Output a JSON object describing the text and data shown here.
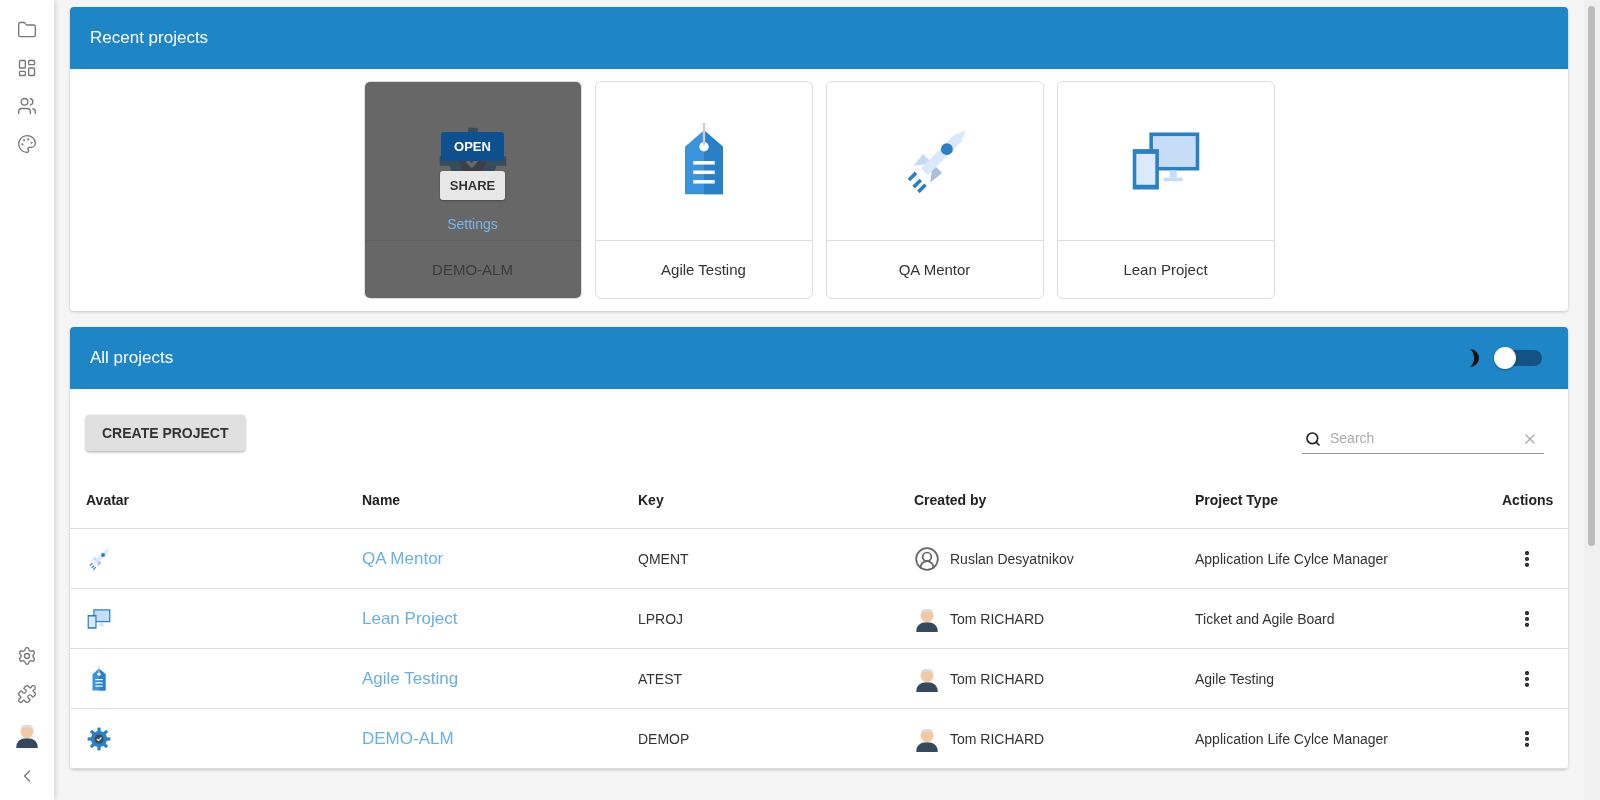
{
  "sidebar": {
    "top_items": [
      {
        "kind": "folder"
      },
      {
        "kind": "dashboard"
      },
      {
        "kind": "people"
      },
      {
        "kind": "palette"
      }
    ],
    "bottom_items": [
      {
        "kind": "settings"
      },
      {
        "kind": "puzzle"
      },
      {
        "kind": "avatar"
      },
      {
        "kind": "collapse"
      }
    ]
  },
  "recent_projects": {
    "title": "Recent projects",
    "cards": [
      {
        "name": "DEMO-ALM",
        "kind": "gear",
        "hovered": true,
        "overlay": {
          "open": "OPEN",
          "share": "SHARE",
          "settings": "Settings"
        }
      },
      {
        "name": "Agile Testing",
        "kind": "tag",
        "hovered": false
      },
      {
        "name": "QA Mentor",
        "kind": "rocket",
        "hovered": false
      },
      {
        "name": "Lean Project",
        "kind": "devices",
        "hovered": false
      }
    ]
  },
  "all_projects": {
    "title": "All projects",
    "dark_mode_toggle": {
      "on": false
    },
    "create_button": "CREATE PROJECT",
    "search": {
      "placeholder": "Search"
    },
    "table": {
      "columns": [
        "Avatar",
        "Name",
        "Key",
        "Created by",
        "Project Type",
        "Actions"
      ],
      "rows": [
        {
          "kind": "rocket",
          "name": "QA Mentor",
          "key": "QMENT",
          "creator": {
            "name": "Ruslan Desyatnikov",
            "kind": "generic"
          },
          "type": "Application Life Cylce Manager"
        },
        {
          "kind": "devices",
          "name": "Lean Project",
          "key": "LPROJ",
          "creator": {
            "name": "Tom RICHARD",
            "kind": "person"
          },
          "type": "Ticket and Agile Board"
        },
        {
          "kind": "tag",
          "name": "Agile Testing",
          "key": "ATEST",
          "creator": {
            "name": "Tom RICHARD",
            "kind": "person"
          },
          "type": "Agile Testing"
        },
        {
          "kind": "gear",
          "name": "DEMO-ALM",
          "key": "DEMOP",
          "creator": {
            "name": "Tom RICHARD",
            "kind": "person"
          },
          "type": "Application Life Cylce Manager"
        }
      ]
    }
  }
}
